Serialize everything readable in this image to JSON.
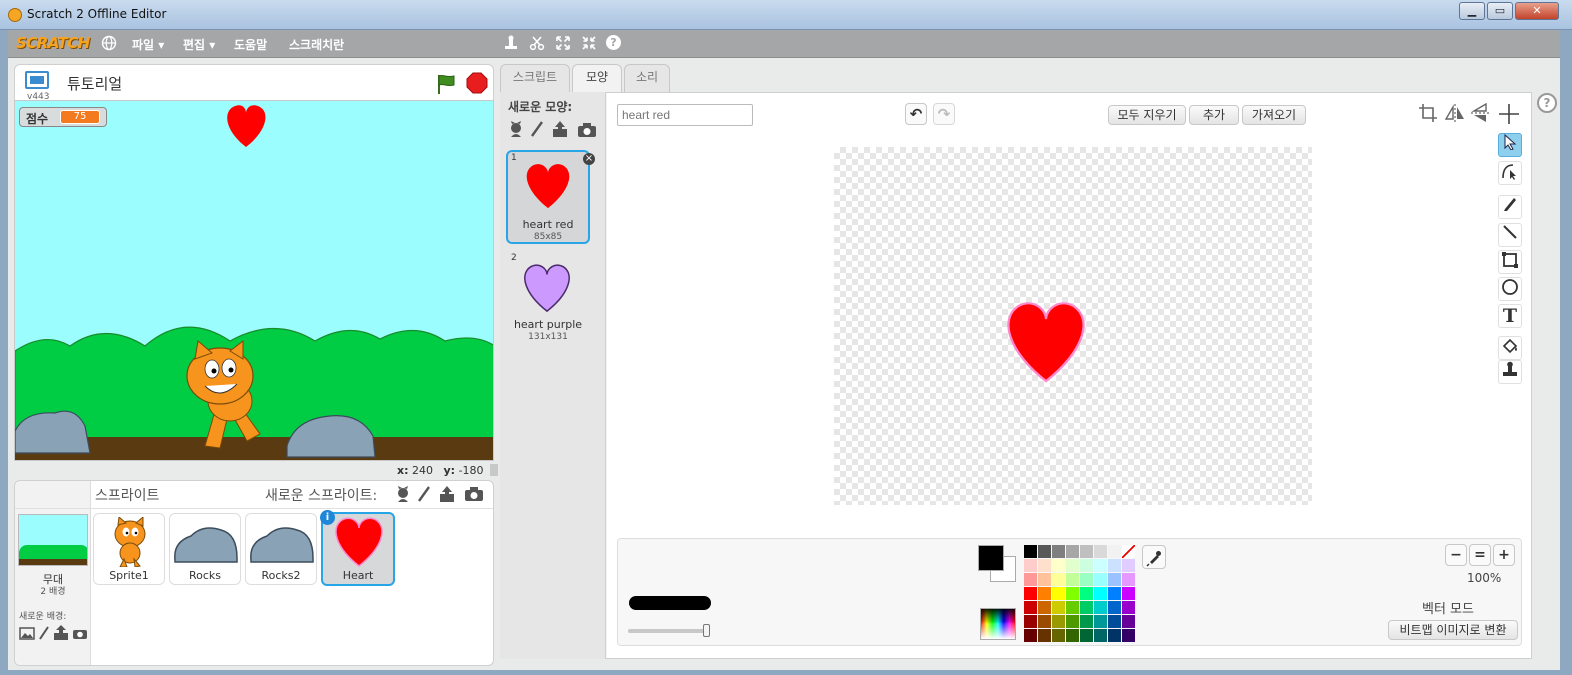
{
  "window": {
    "title": "Scratch 2 Offline Editor",
    "minimize": "▁",
    "maximize": "▭",
    "close": "✕"
  },
  "menubar": {
    "logo": "SCRATCH",
    "items": [
      "파일 ▾",
      "편집 ▾",
      "도움말",
      "스크래치란"
    ],
    "tool_icons": [
      "stamp-icon",
      "cut-icon",
      "grow-icon",
      "shrink-icon",
      "help-icon"
    ],
    "help_glyph": "?"
  },
  "stage": {
    "version": "v443",
    "project_title": "튜토리얼",
    "score_label": "점수",
    "score_value": "75",
    "coord_x_label": "x:",
    "coord_x": "240",
    "coord_y_label": "y:",
    "coord_y": "-180"
  },
  "sprites": {
    "header": "스프라이트",
    "new_sprite_label": "새로운 스프라이트:",
    "stage_label": "무대",
    "stage_count": "2 배경",
    "new_backdrop_label": "새로운 배경:",
    "items": [
      {
        "name": "Sprite1"
      },
      {
        "name": "Rocks"
      },
      {
        "name": "Rocks2"
      },
      {
        "name": "Heart",
        "selected": true
      }
    ],
    "info_glyph": "i"
  },
  "tabs": [
    "스크립트",
    "모양",
    "소리"
  ],
  "active_tab": "모양",
  "costumes": {
    "new_costume_label": "새로운 모양:",
    "items": [
      {
        "index": "1",
        "name": "heart red",
        "size": "85x85",
        "color": "#ff0000",
        "selected": true
      },
      {
        "index": "2",
        "name": "heart purple",
        "size": "131x131",
        "color": "#cc99ff"
      }
    ],
    "delete_glyph": "×"
  },
  "paint_editor": {
    "costume_name_value": "heart red",
    "undo_glyph": "↶",
    "redo_glyph": "↷",
    "clear_label": "모두 지우기",
    "add_label": "추가",
    "import_label": "가져오기",
    "zoom_level": "100%",
    "zoom_out_glyph": "−",
    "zoom_reset_glyph": "=",
    "zoom_in_glyph": "+",
    "mode_label": "벡터 모드",
    "convert_button": "비트맵 이미지로 변환",
    "primary_color": "#000000",
    "secondary_color": "#ffffff",
    "heart_fill": "#ff0000",
    "heart_outline": "#ff88cc",
    "tools": [
      "select-icon",
      "reshape-icon",
      "pencil-icon",
      "line-icon",
      "rectangle-icon",
      "ellipse-icon",
      "text-icon",
      "fill-icon",
      "duplicate-stamp-icon"
    ],
    "text_tool_glyph": "T",
    "palette": [
      [
        "#000000",
        "#595959",
        "#7f7f7f",
        "#a6a6a6",
        "#bfbfbf",
        "#d9d9d9",
        "#f2f2f2",
        "#ffffff"
      ],
      [
        "#ffcccc",
        "#ffe0cc",
        "#ffffcc",
        "#e0ffcc",
        "#ccffe0",
        "#ccffff",
        "#cce0ff",
        "#e0ccff"
      ],
      [
        "#ff9999",
        "#ffc299",
        "#ffff99",
        "#c2ff99",
        "#99ffc2",
        "#99ffff",
        "#99c2ff",
        "#e599ff"
      ],
      [
        "#ff0000",
        "#ff8000",
        "#ffff00",
        "#80ff00",
        "#00ff80",
        "#00ffff",
        "#0080ff",
        "#cc00ff"
      ],
      [
        "#cc0000",
        "#cc6600",
        "#cccc00",
        "#66cc00",
        "#00cc66",
        "#00cccc",
        "#0066cc",
        "#9900cc"
      ],
      [
        "#990000",
        "#994c00",
        "#999900",
        "#4c9900",
        "#00994c",
        "#009999",
        "#004c99",
        "#660099"
      ],
      [
        "#660000",
        "#663300",
        "#666600",
        "#336600",
        "#006633",
        "#006666",
        "#003366",
        "#330066"
      ]
    ]
  },
  "colors": {
    "accent": "#28a5e6",
    "menubar": "#a4a6a8",
    "stage_sky": "#9bfdfd",
    "ground_green": "#00cc44",
    "ground_brown": "#5a3a10"
  }
}
